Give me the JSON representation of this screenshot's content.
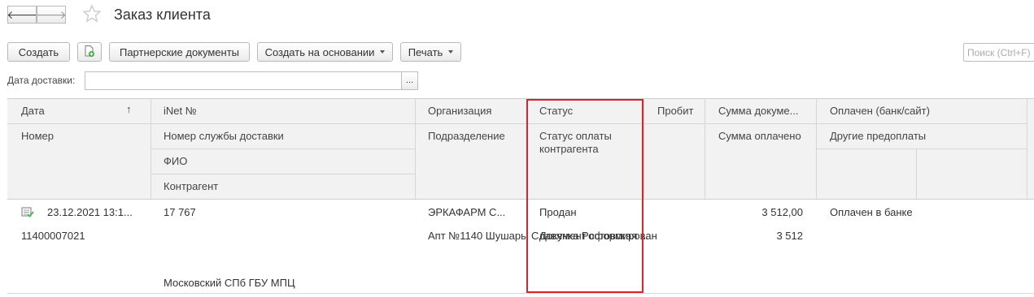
{
  "window": {
    "title": "Заказ клиента"
  },
  "nav": {
    "back_glyph": "🡐",
    "forward_glyph": "🡒"
  },
  "toolbar": {
    "create": "Создать",
    "partner_docs": "Партнерские документы",
    "create_based_on": "Создать на основании",
    "print": "Печать"
  },
  "search": {
    "placeholder": "Поиск (Ctrl+F)"
  },
  "filter": {
    "delivery_date_label": "Дата доставки:",
    "delivery_date_value": "",
    "select_button": "..."
  },
  "columns": {
    "date": "Дата",
    "sort_arrow": "↑",
    "number": "Номер",
    "inet_no": "iNet №",
    "delivery_service_no": "Номер службы доставки",
    "fio": "ФИО",
    "counterparty": "Контрагент",
    "organization": "Организация",
    "subdivision": "Подразделение",
    "status": "Статус",
    "payment_status": "Статус оплаты контрагента",
    "probit": "Пробит",
    "doc_sum": "Сумма докуме...",
    "paid_sum": "Сумма оплачено",
    "paid_bank_site": "Оплачен (банк/сайт)",
    "other_prepayments": "Другие предоплаты"
  },
  "rows": [
    {
      "date": "23.12.2021 13:1...",
      "number": "11400007021",
      "inet_no": "17 767",
      "fio": "",
      "counterparty": "Московский СПб ГБУ МПЦ",
      "organization": "ЭРКАФАРМ С...",
      "subdivision": "Апт №1140 Шушары Славянка Ростовская ...",
      "status": "Продан",
      "payment_status": "Документ сформирован",
      "probit": "",
      "doc_sum": "3 512,00",
      "paid_sum": "3 512",
      "paid_bank_site": "Оплачен в банке"
    }
  ],
  "colors": {
    "highlight_border": "#d9232f",
    "header_bg": "#f2f2f2",
    "row_icon": "#4caf50"
  }
}
